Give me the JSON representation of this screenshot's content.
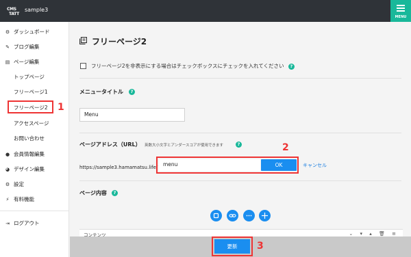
{
  "header": {
    "logo_text": "CMS TATT",
    "site_name": "sample3",
    "menu_label": "MENU"
  },
  "sidebar": {
    "items": [
      {
        "icon": "dashboard-icon",
        "glyph": "⚙",
        "label": "ダッシュボード"
      },
      {
        "icon": "pencil-icon",
        "glyph": "✎",
        "label": "ブログ編集"
      },
      {
        "icon": "pages-icon",
        "glyph": "▤",
        "label": "ページ編集"
      }
    ],
    "sub_items": [
      "トップページ",
      "フリーページ1",
      "フリーページ2",
      "アクセスページ",
      "お問い合わせ"
    ],
    "items2": [
      {
        "icon": "user-icon",
        "glyph": "●",
        "label": "会員情報編集"
      },
      {
        "icon": "palette-icon",
        "glyph": "◕",
        "label": "デザイン編集"
      },
      {
        "icon": "gear-icon",
        "glyph": "⚙",
        "label": "設定"
      },
      {
        "icon": "bolt-icon",
        "glyph": "⚡",
        "label": "有料機能"
      }
    ],
    "logout": {
      "icon": "logout-icon",
      "glyph": "⇥",
      "label": "ログアウト"
    }
  },
  "main": {
    "title": "フリーページ2",
    "hide_checkbox_label": "フリーページ2を非表示にする場合はチェックボックスにチェックを入れてください",
    "menu_title_label": "メニュータイトル",
    "menu_title_value": "Menu",
    "address_label": "ページアドレス（URL）",
    "address_note": "英数大小文字とアンダースコアが使用できます",
    "url_prefix": "https://sample3.hamamatsu.life/",
    "url_value": "menu",
    "ok_label": "OK",
    "cancel_label": "キャンセル",
    "content_label": "ページ内容",
    "content_bar_label": "コンテンツ",
    "update_label": "更新"
  },
  "annotations": {
    "n1": "1",
    "n2": "2",
    "n3": "3",
    "color": "#e33333"
  },
  "colors": {
    "accent": "#19b89a",
    "primary_button": "#1a8ef0",
    "topbar": "#2f3338"
  }
}
